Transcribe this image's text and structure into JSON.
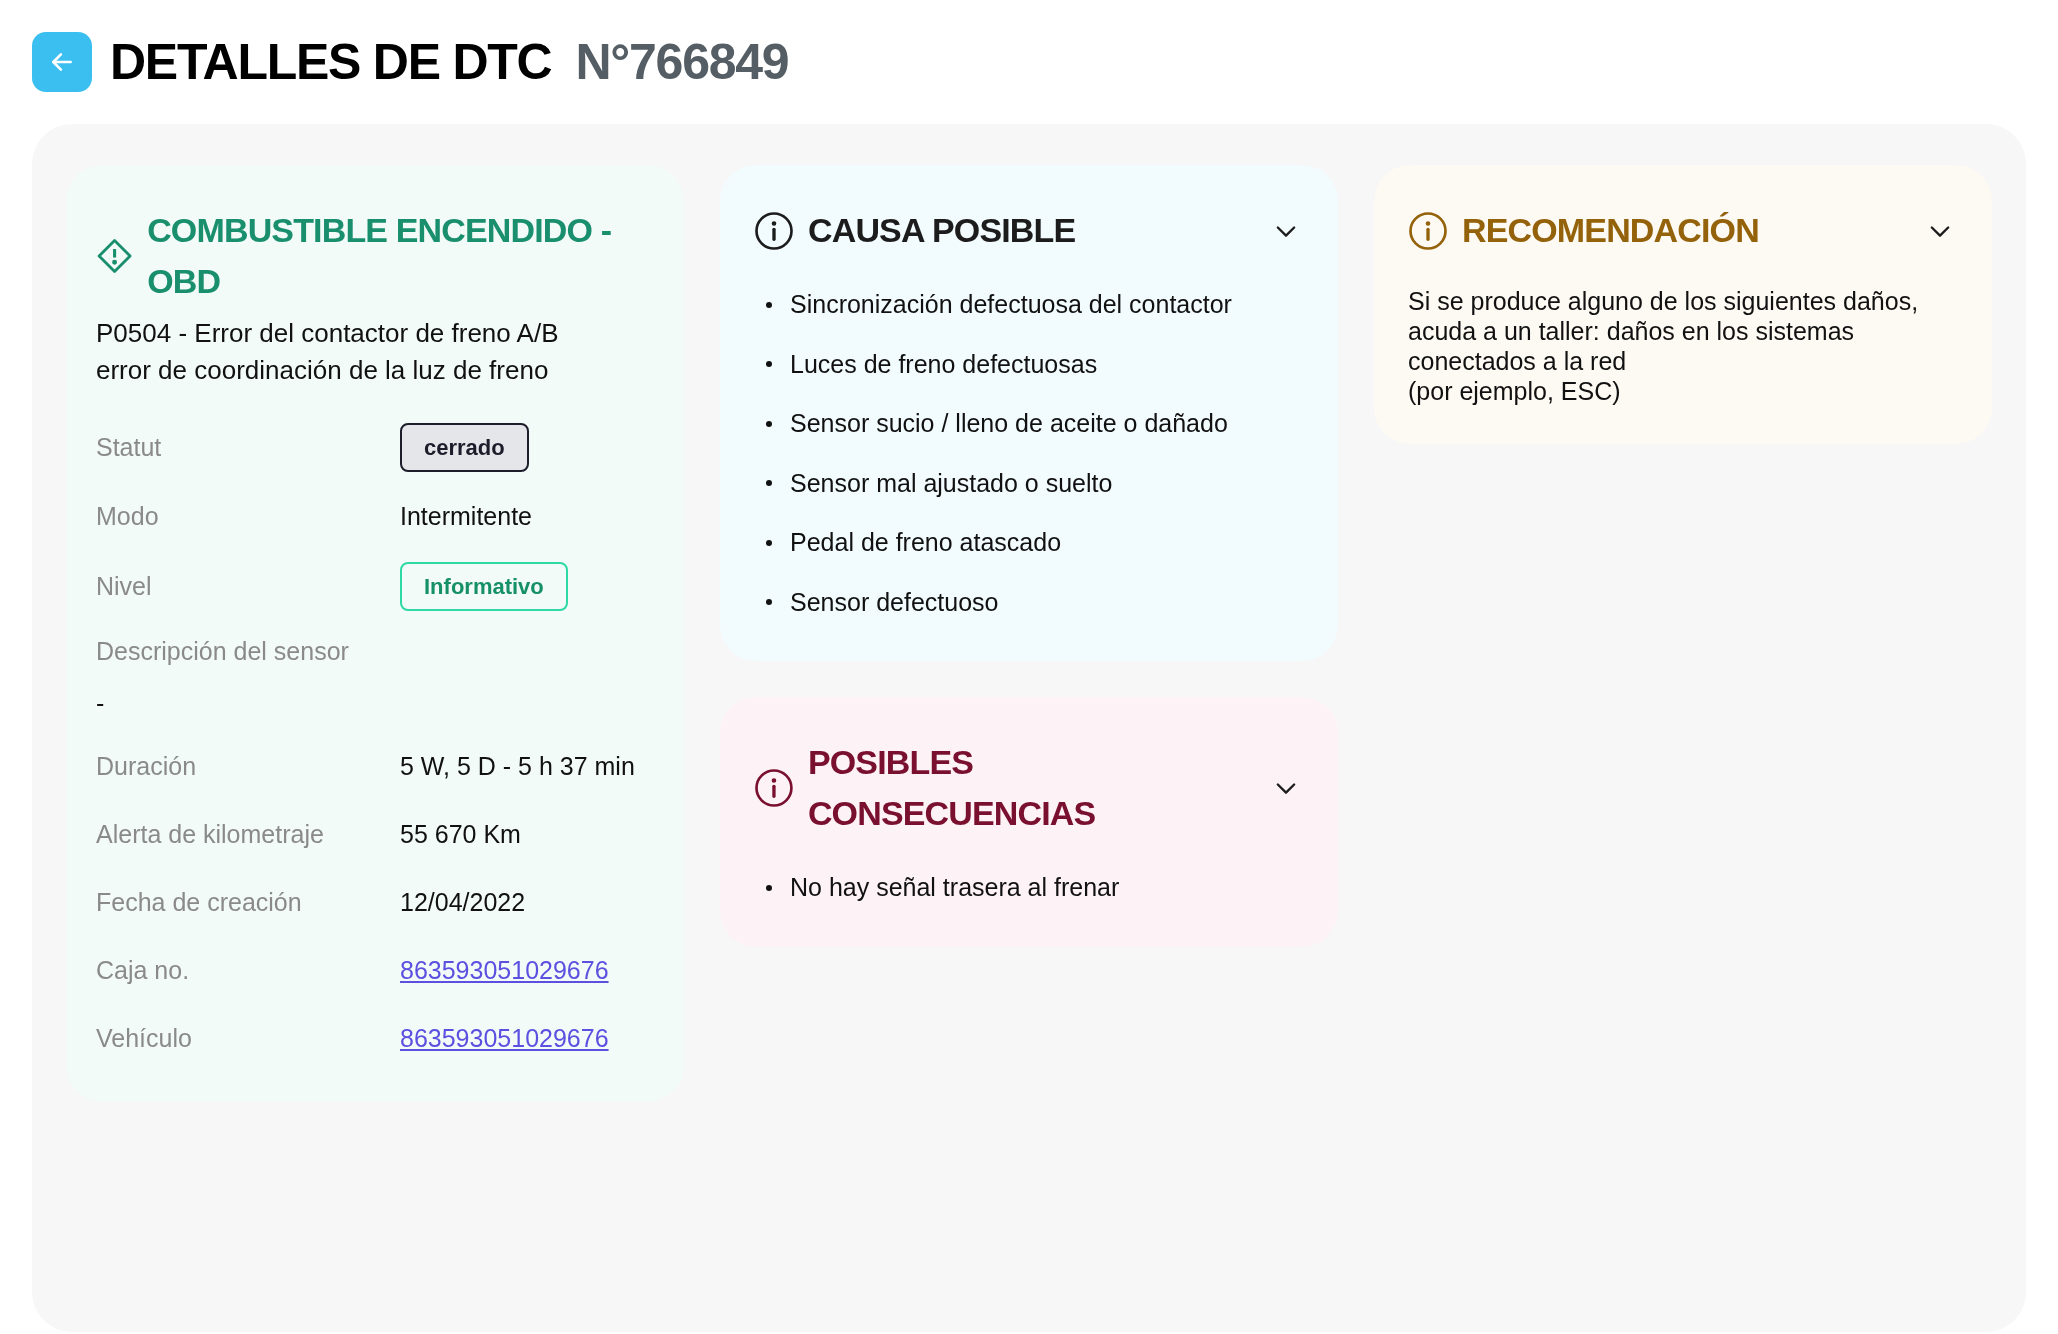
{
  "header": {
    "title": "DETALLES DE DTC",
    "number": "N°766849"
  },
  "details": {
    "title": "COMBUSTIBLE ENCENDIDO - OBD",
    "code_lines": [
      "P0504 - Error del contactor de freno A/B",
      "error de coordinación de la luz de freno"
    ],
    "rows": [
      {
        "kind": "badge",
        "label": "Statut",
        "value": "cerrado"
      },
      {
        "kind": "text",
        "label": "Modo",
        "value": "Intermitente"
      },
      {
        "kind": "tag",
        "label": "Nivel",
        "value": "Informativo"
      },
      {
        "kind": "block",
        "label": "Descripción del sensor",
        "value": "-"
      },
      {
        "kind": "text",
        "label": "Duración",
        "value": "5 W, 5 D - 5 h 37 min"
      },
      {
        "kind": "text",
        "label": "Alerta de kilometraje",
        "value": "55 670 Km"
      },
      {
        "kind": "text",
        "label": "Fecha de creación",
        "value": "12/04/2022"
      },
      {
        "kind": "link",
        "label": "Caja no.",
        "value": "863593051029676"
      },
      {
        "kind": "link",
        "label": "Vehículo",
        "value": "863593051029676"
      }
    ]
  },
  "causes": {
    "title": "CAUSA POSIBLE",
    "expanded": true,
    "items": [
      "Sincronización defectuosa del contactor",
      "Luces de freno defectuosas",
      "Sensor sucio / lleno de aceite o dañado",
      "Sensor mal ajustado o suelto",
      "Pedal de freno atascado",
      "Sensor defectuoso"
    ]
  },
  "consequences": {
    "title": "POSIBLES CONSECUENCIAS",
    "expanded": true,
    "items": [
      "No hay señal trasera al frenar"
    ]
  },
  "recommendation": {
    "title": "RECOMENDACIÓN",
    "expanded": true,
    "lines": [
      "Si se produce alguno de los siguientes daños,",
      "acuda a un taller: daños en los sistemas",
      "conectados a la red",
      "(por ejemplo, ESC)"
    ]
  }
}
